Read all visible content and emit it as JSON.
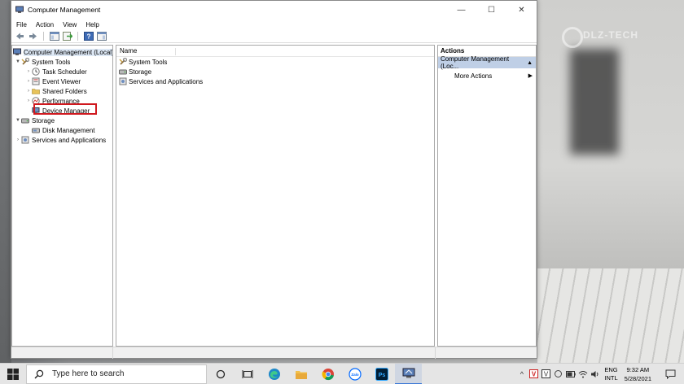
{
  "window": {
    "title": "Computer Management",
    "controls": {
      "minimize": "—",
      "maximize": "☐",
      "close": "✕"
    }
  },
  "menu": [
    "File",
    "Action",
    "View",
    "Help"
  ],
  "tree": {
    "root": "Computer Management (Local)",
    "system_tools": "System Tools",
    "task_scheduler": "Task Scheduler",
    "event_viewer": "Event Viewer",
    "shared_folders": "Shared Folders",
    "performance": "Performance",
    "device_manager": "Device Manager",
    "storage": "Storage",
    "disk_management": "Disk Management",
    "services_apps": "Services and Applications"
  },
  "center": {
    "column_name": "Name",
    "rows": [
      "System Tools",
      "Storage",
      "Services and Applications"
    ]
  },
  "actions": {
    "header": "Actions",
    "selected": "Computer Management (Loc...",
    "more": "More Actions"
  },
  "taskbar": {
    "search_placeholder": "Type here to search",
    "zalo_label": "Zalo",
    "ps_label": "Ps",
    "lang_top": "ENG",
    "lang_bottom": "INTL",
    "time": "9:32 AM",
    "date": "5/28/2021"
  },
  "watermark": "DLZ-TECH",
  "colors": {
    "highlight_border": "#d0191f",
    "selection": "#bfcfe6",
    "accent": "#3b78d6"
  }
}
